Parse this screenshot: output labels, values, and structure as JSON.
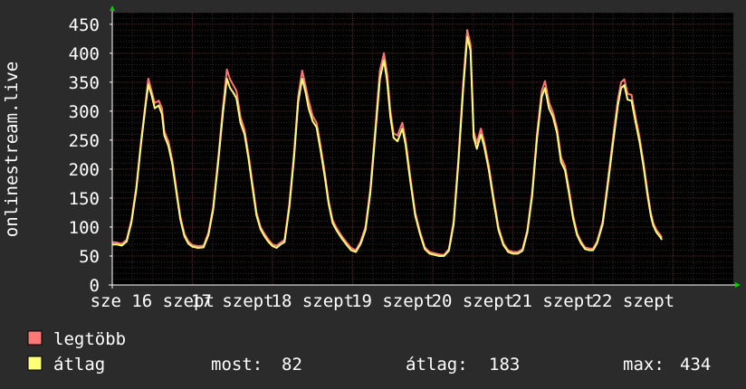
{
  "chart_data": {
    "type": "line",
    "title": "",
    "xlabel": "",
    "ylabel": "onlinestream.live",
    "ylim": [
      0,
      470
    ],
    "yticks": [
      0,
      50,
      100,
      150,
      200,
      250,
      300,
      350,
      400,
      450
    ],
    "xlim": [
      0,
      7.75
    ],
    "xtick_labels": [
      {
        "x": 0.5,
        "label": "sze 16 szept"
      },
      {
        "x": 1.5,
        "label": "17 szept"
      },
      {
        "x": 2.5,
        "label": "18 szept"
      },
      {
        "x": 3.5,
        "label": "19 szept"
      },
      {
        "x": 4.5,
        "label": "20 szept"
      },
      {
        "x": 5.5,
        "label": "21 szept"
      },
      {
        "x": 6.5,
        "label": "22 szept"
      }
    ],
    "grid": true,
    "colors": {
      "background": "#2b2b2b",
      "plot_background": "#000000",
      "grid_major": "#5a2a2a",
      "grid_minor": "#3a2a2a",
      "axis_arrow": "#00cc00",
      "text": "#ffffff",
      "legtobb": "#ff7777",
      "atlag": "#ffff77"
    },
    "series": [
      {
        "name": "legtöbb",
        "color": "#ff7777",
        "points": [
          [
            0,
            74
          ],
          [
            0.06,
            73
          ],
          [
            0.12,
            71
          ],
          [
            0.18,
            78
          ],
          [
            0.24,
            112
          ],
          [
            0.3,
            170
          ],
          [
            0.36,
            250
          ],
          [
            0.42,
            320
          ],
          [
            0.45,
            356
          ],
          [
            0.49,
            335
          ],
          [
            0.53,
            314
          ],
          [
            0.58,
            318
          ],
          [
            0.62,
            305
          ],
          [
            0.65,
            265
          ],
          [
            0.7,
            248
          ],
          [
            0.75,
            215
          ],
          [
            0.8,
            165
          ],
          [
            0.85,
            118
          ],
          [
            0.9,
            88
          ],
          [
            0.95,
            75
          ],
          [
            1.0,
            69
          ],
          [
            1.07,
            67
          ],
          [
            1.14,
            68
          ],
          [
            1.2,
            90
          ],
          [
            1.26,
            135
          ],
          [
            1.32,
            215
          ],
          [
            1.38,
            305
          ],
          [
            1.43,
            372
          ],
          [
            1.47,
            355
          ],
          [
            1.51,
            345
          ],
          [
            1.55,
            335
          ],
          [
            1.6,
            290
          ],
          [
            1.65,
            268
          ],
          [
            1.7,
            225
          ],
          [
            1.75,
            175
          ],
          [
            1.8,
            125
          ],
          [
            1.85,
            100
          ],
          [
            1.9,
            88
          ],
          [
            1.95,
            78
          ],
          [
            2.0,
            70
          ],
          [
            2.05,
            68
          ],
          [
            2.1,
            73
          ],
          [
            2.15,
            78
          ],
          [
            2.21,
            140
          ],
          [
            2.27,
            230
          ],
          [
            2.32,
            325
          ],
          [
            2.37,
            370
          ],
          [
            2.41,
            345
          ],
          [
            2.45,
            318
          ],
          [
            2.5,
            292
          ],
          [
            2.55,
            280
          ],
          [
            2.6,
            240
          ],
          [
            2.65,
            195
          ],
          [
            2.7,
            145
          ],
          [
            2.75,
            112
          ],
          [
            2.8,
            98
          ],
          [
            2.86,
            85
          ],
          [
            2.92,
            74
          ],
          [
            2.98,
            64
          ],
          [
            3.04,
            60
          ],
          [
            3.1,
            75
          ],
          [
            3.16,
            100
          ],
          [
            3.22,
            165
          ],
          [
            3.28,
            265
          ],
          [
            3.34,
            370
          ],
          [
            3.39,
            400
          ],
          [
            3.43,
            365
          ],
          [
            3.47,
            300
          ],
          [
            3.51,
            262
          ],
          [
            3.56,
            258
          ],
          [
            3.62,
            280
          ],
          [
            3.66,
            250
          ],
          [
            3.72,
            185
          ],
          [
            3.78,
            125
          ],
          [
            3.84,
            92
          ],
          [
            3.9,
            65
          ],
          [
            3.96,
            57
          ],
          [
            4.02,
            55
          ],
          [
            4.08,
            53
          ],
          [
            4.14,
            52
          ],
          [
            4.2,
            62
          ],
          [
            4.26,
            110
          ],
          [
            4.32,
            220
          ],
          [
            4.38,
            350
          ],
          [
            4.43,
            440
          ],
          [
            4.47,
            415
          ],
          [
            4.51,
            265
          ],
          [
            4.55,
            245
          ],
          [
            4.6,
            270
          ],
          [
            4.64,
            248
          ],
          [
            4.7,
            205
          ],
          [
            4.76,
            150
          ],
          [
            4.82,
            100
          ],
          [
            4.88,
            72
          ],
          [
            4.94,
            60
          ],
          [
            5.0,
            57
          ],
          [
            5.06,
            57
          ],
          [
            5.12,
            62
          ],
          [
            5.18,
            95
          ],
          [
            5.24,
            160
          ],
          [
            5.3,
            260
          ],
          [
            5.36,
            335
          ],
          [
            5.4,
            352
          ],
          [
            5.45,
            315
          ],
          [
            5.5,
            298
          ],
          [
            5.55,
            270
          ],
          [
            5.6,
            220
          ],
          [
            5.65,
            205
          ],
          [
            5.7,
            165
          ],
          [
            5.75,
            120
          ],
          [
            5.8,
            90
          ],
          [
            5.85,
            75
          ],
          [
            5.9,
            65
          ],
          [
            5.95,
            63
          ],
          [
            6.0,
            63
          ],
          [
            6.05,
            75
          ],
          [
            6.12,
            110
          ],
          [
            6.18,
            175
          ],
          [
            6.25,
            255
          ],
          [
            6.31,
            320
          ],
          [
            6.35,
            350
          ],
          [
            6.39,
            355
          ],
          [
            6.43,
            330
          ],
          [
            6.48,
            328
          ],
          [
            6.53,
            290
          ],
          [
            6.58,
            255
          ],
          [
            6.63,
            210
          ],
          [
            6.68,
            160
          ],
          [
            6.72,
            125
          ],
          [
            6.75,
            107
          ],
          [
            6.79,
            95
          ],
          [
            6.83,
            88
          ],
          [
            6.86,
            82
          ]
        ]
      },
      {
        "name": "átlag",
        "color": "#ffff77",
        "points": [
          [
            0,
            70
          ],
          [
            0.06,
            70
          ],
          [
            0.12,
            68
          ],
          [
            0.18,
            75
          ],
          [
            0.24,
            108
          ],
          [
            0.3,
            165
          ],
          [
            0.36,
            245
          ],
          [
            0.42,
            315
          ],
          [
            0.45,
            346
          ],
          [
            0.49,
            328
          ],
          [
            0.53,
            305
          ],
          [
            0.58,
            310
          ],
          [
            0.62,
            295
          ],
          [
            0.65,
            258
          ],
          [
            0.7,
            240
          ],
          [
            0.75,
            208
          ],
          [
            0.8,
            160
          ],
          [
            0.85,
            113
          ],
          [
            0.9,
            84
          ],
          [
            0.95,
            71
          ],
          [
            1.0,
            66
          ],
          [
            1.07,
            64
          ],
          [
            1.14,
            65
          ],
          [
            1.2,
            86
          ],
          [
            1.26,
            130
          ],
          [
            1.32,
            208
          ],
          [
            1.38,
            296
          ],
          [
            1.43,
            356
          ],
          [
            1.47,
            340
          ],
          [
            1.51,
            332
          ],
          [
            1.55,
            322
          ],
          [
            1.6,
            280
          ],
          [
            1.65,
            260
          ],
          [
            1.7,
            218
          ],
          [
            1.75,
            168
          ],
          [
            1.8,
            120
          ],
          [
            1.85,
            96
          ],
          [
            1.9,
            84
          ],
          [
            1.95,
            74
          ],
          [
            2.0,
            67
          ],
          [
            2.05,
            64
          ],
          [
            2.1,
            70
          ],
          [
            2.15,
            74
          ],
          [
            2.21,
            134
          ],
          [
            2.27,
            222
          ],
          [
            2.32,
            316
          ],
          [
            2.37,
            356
          ],
          [
            2.41,
            334
          ],
          [
            2.45,
            305
          ],
          [
            2.5,
            283
          ],
          [
            2.55,
            272
          ],
          [
            2.6,
            232
          ],
          [
            2.65,
            188
          ],
          [
            2.7,
            140
          ],
          [
            2.75,
            107
          ],
          [
            2.8,
            94
          ],
          [
            2.86,
            81
          ],
          [
            2.92,
            70
          ],
          [
            2.98,
            60
          ],
          [
            3.04,
            57
          ],
          [
            3.1,
            71
          ],
          [
            3.16,
            95
          ],
          [
            3.22,
            158
          ],
          [
            3.28,
            256
          ],
          [
            3.34,
            356
          ],
          [
            3.39,
            388
          ],
          [
            3.43,
            352
          ],
          [
            3.47,
            290
          ],
          [
            3.51,
            254
          ],
          [
            3.56,
            248
          ],
          [
            3.62,
            270
          ],
          [
            3.66,
            242
          ],
          [
            3.72,
            178
          ],
          [
            3.78,
            120
          ],
          [
            3.84,
            88
          ],
          [
            3.9,
            62
          ],
          [
            3.96,
            54
          ],
          [
            4.02,
            52
          ],
          [
            4.08,
            50
          ],
          [
            4.14,
            50
          ],
          [
            4.2,
            59
          ],
          [
            4.26,
            105
          ],
          [
            4.32,
            212
          ],
          [
            4.38,
            340
          ],
          [
            4.43,
            428
          ],
          [
            4.47,
            405
          ],
          [
            4.51,
            255
          ],
          [
            4.55,
            235
          ],
          [
            4.6,
            260
          ],
          [
            4.64,
            240
          ],
          [
            4.7,
            198
          ],
          [
            4.76,
            144
          ],
          [
            4.82,
            95
          ],
          [
            4.88,
            69
          ],
          [
            4.94,
            57
          ],
          [
            5.0,
            54
          ],
          [
            5.06,
            54
          ],
          [
            5.12,
            59
          ],
          [
            5.18,
            91
          ],
          [
            5.24,
            154
          ],
          [
            5.3,
            252
          ],
          [
            5.36,
            325
          ],
          [
            5.4,
            340
          ],
          [
            5.45,
            305
          ],
          [
            5.5,
            290
          ],
          [
            5.55,
            262
          ],
          [
            5.6,
            212
          ],
          [
            5.65,
            198
          ],
          [
            5.7,
            158
          ],
          [
            5.75,
            115
          ],
          [
            5.8,
            86
          ],
          [
            5.85,
            72
          ],
          [
            5.9,
            62
          ],
          [
            5.95,
            60
          ],
          [
            6.0,
            60
          ],
          [
            6.05,
            72
          ],
          [
            6.12,
            105
          ],
          [
            6.18,
            168
          ],
          [
            6.25,
            246
          ],
          [
            6.31,
            310
          ],
          [
            6.35,
            340
          ],
          [
            6.39,
            345
          ],
          [
            6.43,
            320
          ],
          [
            6.48,
            318
          ],
          [
            6.53,
            281
          ],
          [
            6.58,
            247
          ],
          [
            6.63,
            203
          ],
          [
            6.68,
            154
          ],
          [
            6.72,
            120
          ],
          [
            6.75,
            103
          ],
          [
            6.79,
            91
          ],
          [
            6.83,
            84
          ],
          [
            6.86,
            78
          ]
        ]
      }
    ]
  },
  "legend": {
    "items": [
      {
        "label": "legtöbb",
        "color": "#ff7777"
      },
      {
        "label": "átlag",
        "color": "#ffff77"
      }
    ],
    "stats": {
      "most_label": "most:",
      "most_value": "82",
      "atlag_label": "átlag:",
      "atlag_value": "183",
      "max_label": "max:",
      "max_value": "434"
    }
  }
}
